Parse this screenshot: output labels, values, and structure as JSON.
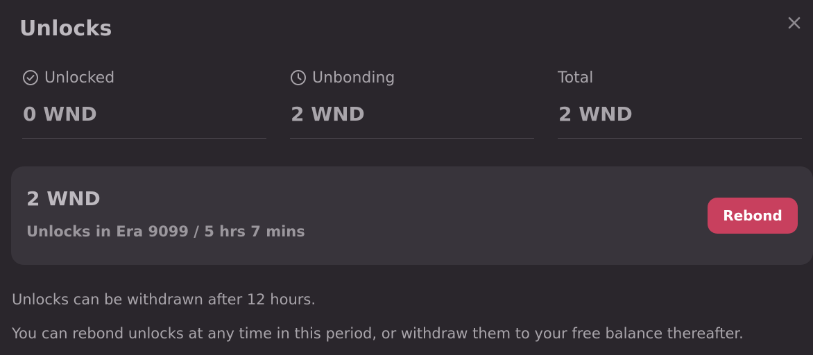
{
  "modal": {
    "title": "Unlocks",
    "close_icon": "close-icon"
  },
  "stats": [
    {
      "icon": "check-circle-icon",
      "label": "Unlocked",
      "value": "0 WND"
    },
    {
      "icon": "clock-icon",
      "label": "Unbonding",
      "value": "2 WND"
    },
    {
      "icon": "",
      "label": "Total",
      "value": "2 WND"
    }
  ],
  "unlock_item": {
    "amount": "2 WND",
    "detail": "Unlocks in Era 9099 / 5 hrs 7 mins",
    "button_label": "Rebond"
  },
  "notes": [
    "Unlocks can be withdrawn after 12 hours.",
    "You can rebond unlocks at any time in this period, or withdraw them to your free balance thereafter."
  ],
  "colors": {
    "background": "#2a262c",
    "card": "#38343b",
    "accent": "#c8405e"
  }
}
